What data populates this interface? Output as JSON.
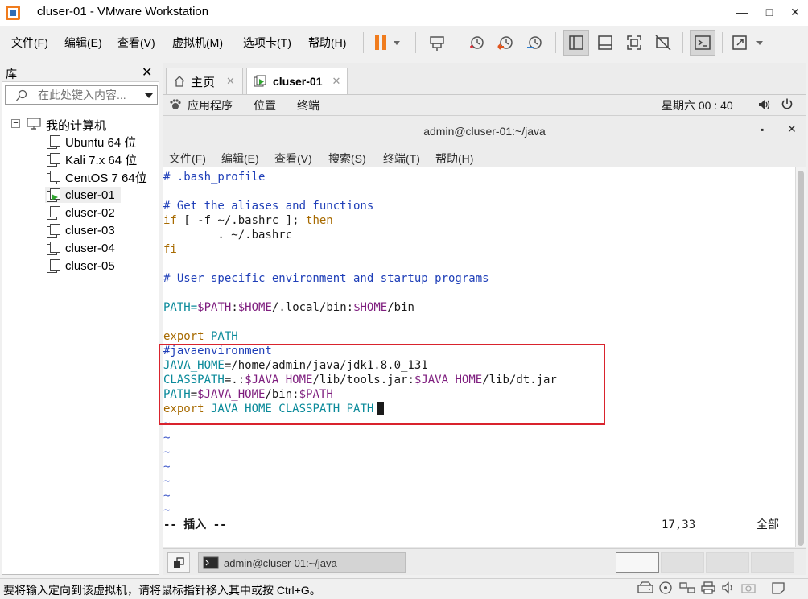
{
  "window": {
    "title": "cluser-01 - VMware Workstation",
    "minimize": "—",
    "maximize": "□",
    "close": "✕"
  },
  "menu": [
    "文件(F)",
    "编辑(E)",
    "查看(V)",
    "虚拟机(M)",
    "选项卡(T)",
    "帮助(H)"
  ],
  "library": {
    "title": "库",
    "close": "✕",
    "search_placeholder": "在此处键入内容...",
    "root": "我的计算机",
    "items": [
      "Ubuntu 64 位",
      "Kali 7.x 64 位",
      "CentOS 7 64位",
      "cluser-01",
      "cluser-02",
      "cluser-03",
      "cluser-04",
      "cluser-05"
    ],
    "selected": "cluser-01"
  },
  "tabs": [
    {
      "label": "主页",
      "close": "✕",
      "icon": "home-icon"
    },
    {
      "label": "cluser-01",
      "close": "✕",
      "icon": "vm-running-icon"
    }
  ],
  "gnome": {
    "apps": "应用程序",
    "places": "位置",
    "terminal": "终端",
    "clock": "星期六  00 : 40"
  },
  "terminal": {
    "title": "admin@cluser-01:~/java",
    "minimize": "—",
    "maximize": "▪",
    "close": "✕",
    "menu": [
      "文件(F)",
      "编辑(E)",
      "查看(V)",
      "搜索(S)",
      "终端(T)",
      "帮助(H)"
    ]
  },
  "editor": {
    "l1": "# .bash_profile",
    "l3": "# Get the aliases and functions",
    "l4_if": "if",
    "l4_mid": " [ -f ~/.bashrc ]; ",
    "l4_then": "then",
    "l5": "        . ~/.bashrc",
    "l6": "fi",
    "l8": "# User specific environment and startup programs",
    "l10_a": "PATH=",
    "l10_b": "$PATH",
    "l10_c": ":",
    "l10_d": "$HOME",
    "l10_e": "/.local/bin:",
    "l10_f": "$HOME",
    "l10_g": "/bin",
    "l12_a": "export",
    "l12_b": " PATH",
    "l13": "#javaenvironment",
    "l14_a": "JAVA_HOME",
    "l14_b": "=/home/admin/java/jdk1.8.0_131",
    "l15_a": "CLASSPATH",
    "l15_b": "=.:",
    "l15_c": "$JAVA_HOME",
    "l15_d": "/lib/tools.jar:",
    "l15_e": "$JAVA_HOME",
    "l15_f": "/lib/dt.jar",
    "l16_a": "PATH",
    "l16_b": "=",
    "l16_c": "$JAVA_HOME",
    "l16_d": "/bin:",
    "l16_e": "$PATH",
    "l17_a": "export",
    "l17_b": " JAVA_HOME CLASSPATH PATH",
    "tilde": "~",
    "mode": "-- 插入 --",
    "position": "17,33",
    "scope": "全部"
  },
  "taskbar": {
    "item": "admin@cluser-01:~/java"
  },
  "status": {
    "text": "要将输入定向到该虚拟机，请将鼠标指针移入其中或按 Ctrl+G。"
  },
  "colors": {
    "highlight_box": "#d9232d",
    "pause_orange": "#f07c1e",
    "comment_blue": "#1f3fb8",
    "keyword_orange": "#a76a00",
    "variable_teal": "#0a8a9a",
    "value_purple": "#7e1d7e"
  }
}
